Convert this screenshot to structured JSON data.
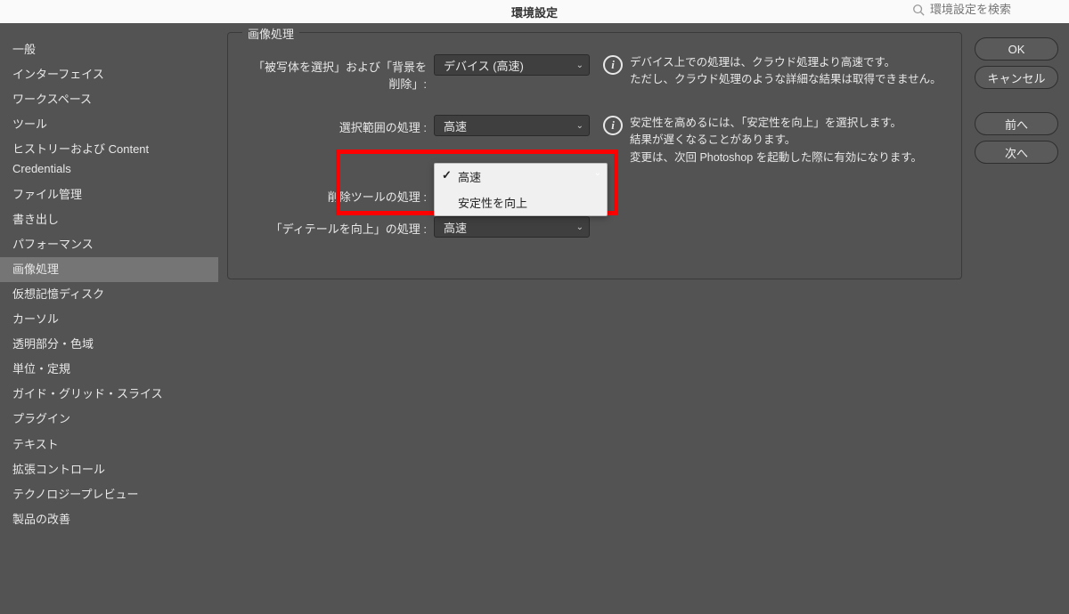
{
  "titlebar": {
    "title": "環境設定",
    "search_placeholder": "環境設定を検索"
  },
  "sidebar": {
    "items": [
      "一般",
      "インターフェイス",
      "ワークスペース",
      "ツール",
      "ヒストリーおよび Content Credentials",
      "ファイル管理",
      "書き出し",
      "パフォーマンス",
      "画像処理",
      "仮想記憶ディスク",
      "カーソル",
      "透明部分・色域",
      "単位・定規",
      "ガイド・グリッド・スライス",
      "プラグイン",
      "テキスト",
      "拡張コントロール",
      "テクノロジープレビュー",
      "製品の改善"
    ],
    "active_index": 8
  },
  "panel": {
    "title": "画像処理",
    "rows": [
      {
        "label": "「被写体を選択」および「背景を削除」:",
        "value": "デバイス (高速)",
        "info": "デバイス上での処理は、クラウド処理より高速です。\nただし、クラウド処理のような詳細な結果は取得できません。"
      },
      {
        "label": "選択範囲の処理 :",
        "value": "高速",
        "info": "安定性を高めるには、「安定性を向上」を選択します。\n結果が遅くなることがあります。\n変更は、次回 Photoshop を起動した際に有効になります。"
      },
      {
        "label": "削除ツールの処理 :",
        "value": "高速",
        "info": ""
      },
      {
        "label": "「ディテールを向上」の処理 :",
        "value": "高速",
        "info": ""
      }
    ]
  },
  "dropdown": {
    "items": [
      "高速",
      "安定性を向上"
    ],
    "checked_index": 0
  },
  "buttons": {
    "ok": "OK",
    "cancel": "キャンセル",
    "prev": "前へ",
    "next": "次へ"
  }
}
